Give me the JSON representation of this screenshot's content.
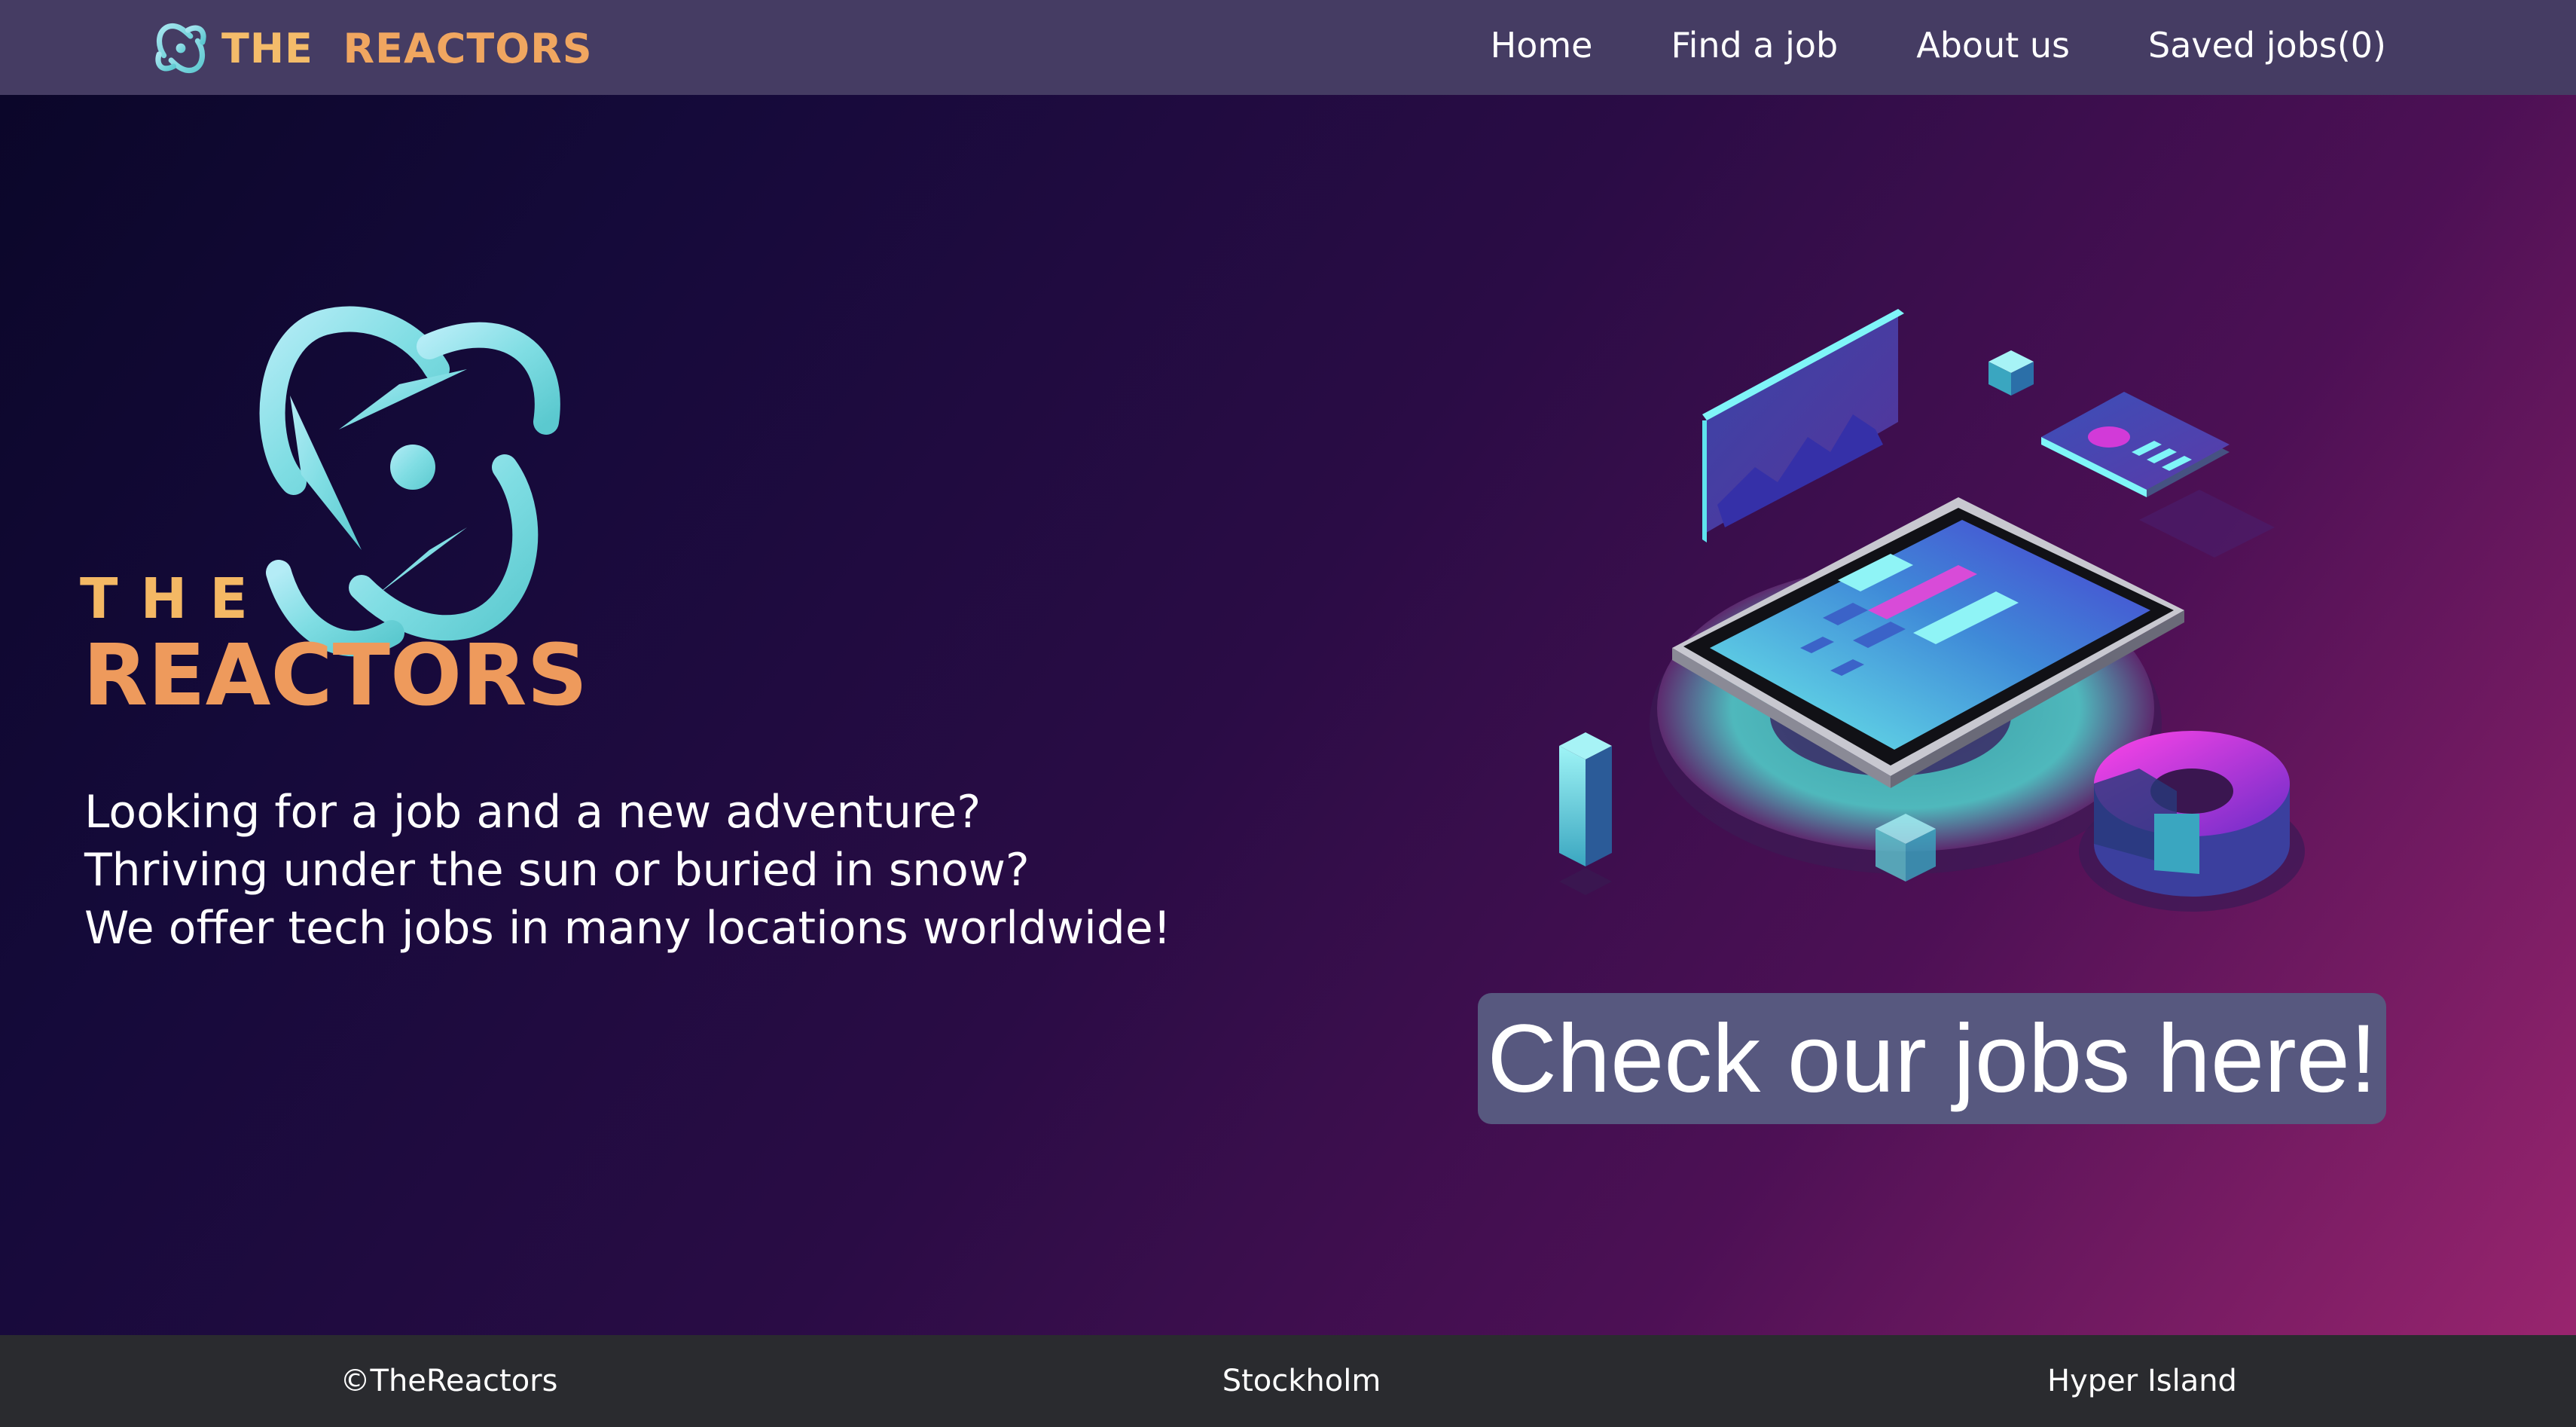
{
  "brand": {
    "name_the": "THE",
    "name_reactors": "REACTORS",
    "logo_icon": "atom-orbit-logo"
  },
  "nav": {
    "items": [
      {
        "label": "Home"
      },
      {
        "label": "Find a job"
      },
      {
        "label": "About us"
      },
      {
        "label": "Saved jobs(0)"
      }
    ]
  },
  "hero": {
    "logo_the": "THE",
    "logo_reactors": "REACTORS",
    "lines": [
      "Looking for a job and a new adventure?",
      "Thriving under the sun or buried in snow?",
      "We offer tech jobs in many locations worldwide!"
    ],
    "illustration_icon": "isometric-tablet-illustration",
    "cta_label": "Check our jobs here!"
  },
  "footer": {
    "copyright": "©TheReactors",
    "city": "Stockholm",
    "school": "Hyper Island"
  },
  "colors": {
    "nav_bg": "#453c63",
    "brand_orange": "#f0a660",
    "logo_cyan": "#7ee0e6",
    "cta_bg": "#57587f",
    "footer_bg": "#2a2b2f",
    "bg_gradient_start": "#0a0628",
    "bg_gradient_end": "#9e2670"
  }
}
